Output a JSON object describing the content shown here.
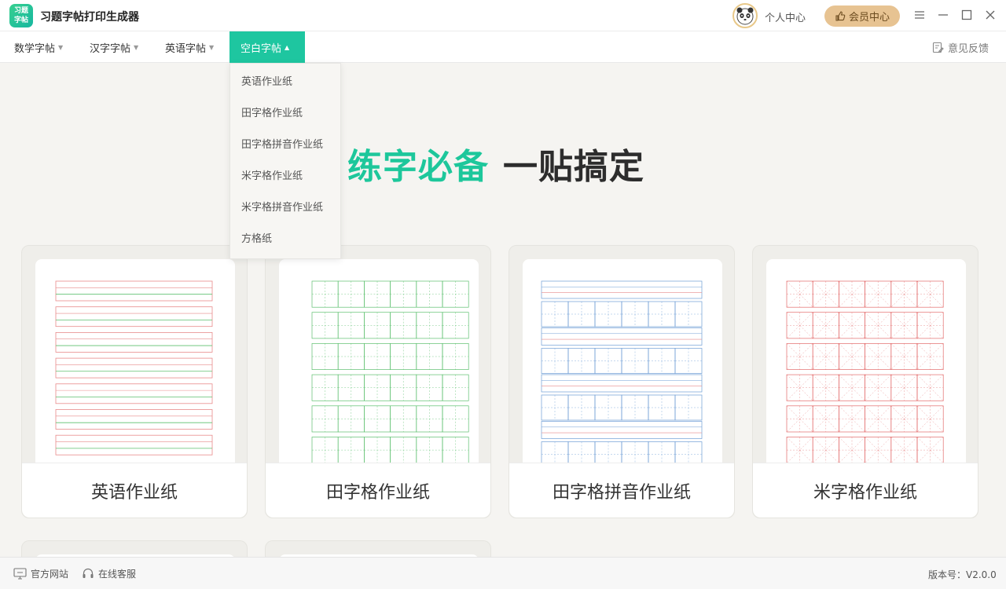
{
  "app": {
    "title": "习题字帖打印生成器",
    "logo_line1": "习题",
    "logo_line2": "字帖"
  },
  "titlebar": {
    "user_center": "个人中心",
    "vip_center": "会员中心"
  },
  "menu": {
    "items": [
      {
        "label": "数学字帖"
      },
      {
        "label": "汉字字帖"
      },
      {
        "label": "英语字帖"
      },
      {
        "label": "空白字帖"
      }
    ],
    "feedback": "意见反馈"
  },
  "dropdown": {
    "items": [
      {
        "label": "英语作业纸"
      },
      {
        "label": "田字格作业纸"
      },
      {
        "label": "田字格拼音作业纸"
      },
      {
        "label": "米字格作业纸"
      },
      {
        "label": "米字格拼音作业纸"
      },
      {
        "label": "方格纸"
      }
    ]
  },
  "hero": {
    "green_text": "练字必备",
    "dark_text": "一贴搞定"
  },
  "cards": [
    {
      "label": "英语作业纸"
    },
    {
      "label": "田字格作业纸"
    },
    {
      "label": "田字格拼音作业纸"
    },
    {
      "label": "米字格作业纸"
    }
  ],
  "footer": {
    "official_site": "官方网站",
    "online_service": "在线客服",
    "version": "版本号：V2.0.0"
  },
  "colors": {
    "accent": "#1ec6a0",
    "vip": "#e7c392",
    "english_line": "#e88a8a",
    "tian_line": "#5cbf6e",
    "pinyin_line": "#6f9ed6",
    "mi_line": "#e36b6b"
  }
}
